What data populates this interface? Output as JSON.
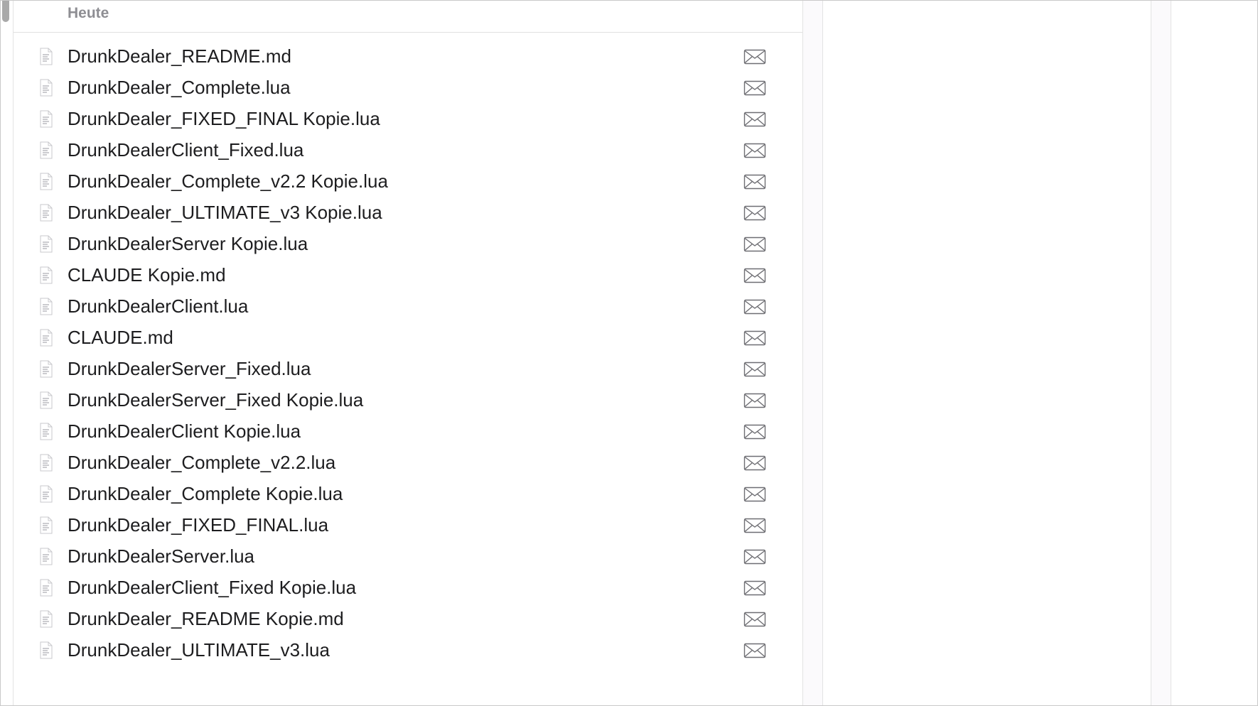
{
  "list": {
    "group_header": "Heute",
    "files": [
      {
        "name": "DrunkDealer_README.md"
      },
      {
        "name": "DrunkDealer_Complete.lua"
      },
      {
        "name": "DrunkDealer_FIXED_FINAL Kopie.lua"
      },
      {
        "name": "DrunkDealerClient_Fixed.lua"
      },
      {
        "name": "DrunkDealer_Complete_v2.2 Kopie.lua"
      },
      {
        "name": "DrunkDealer_ULTIMATE_v3 Kopie.lua"
      },
      {
        "name": "DrunkDealerServer Kopie.lua"
      },
      {
        "name": "CLAUDE Kopie.md"
      },
      {
        "name": "DrunkDealerClient.lua"
      },
      {
        "name": "CLAUDE.md"
      },
      {
        "name": "DrunkDealerServer_Fixed.lua"
      },
      {
        "name": "DrunkDealerServer_Fixed Kopie.lua"
      },
      {
        "name": "DrunkDealerClient Kopie.lua"
      },
      {
        "name": "DrunkDealer_Complete_v2.2.lua"
      },
      {
        "name": "DrunkDealer_Complete Kopie.lua"
      },
      {
        "name": "DrunkDealer_FIXED_FINAL.lua"
      },
      {
        "name": "DrunkDealerServer.lua"
      },
      {
        "name": "DrunkDealerClient_Fixed Kopie.lua"
      },
      {
        "name": "DrunkDealer_README Kopie.md"
      },
      {
        "name": "DrunkDealer_ULTIMATE_v3.lua"
      }
    ],
    "row_icon": "document-icon",
    "row_action_icon": "mail-icon"
  },
  "colors": {
    "text": "#1d1d1f",
    "header_text": "#8e8e93",
    "icon_stroke": "#6e6e73",
    "divider": "#e3e3e3"
  }
}
